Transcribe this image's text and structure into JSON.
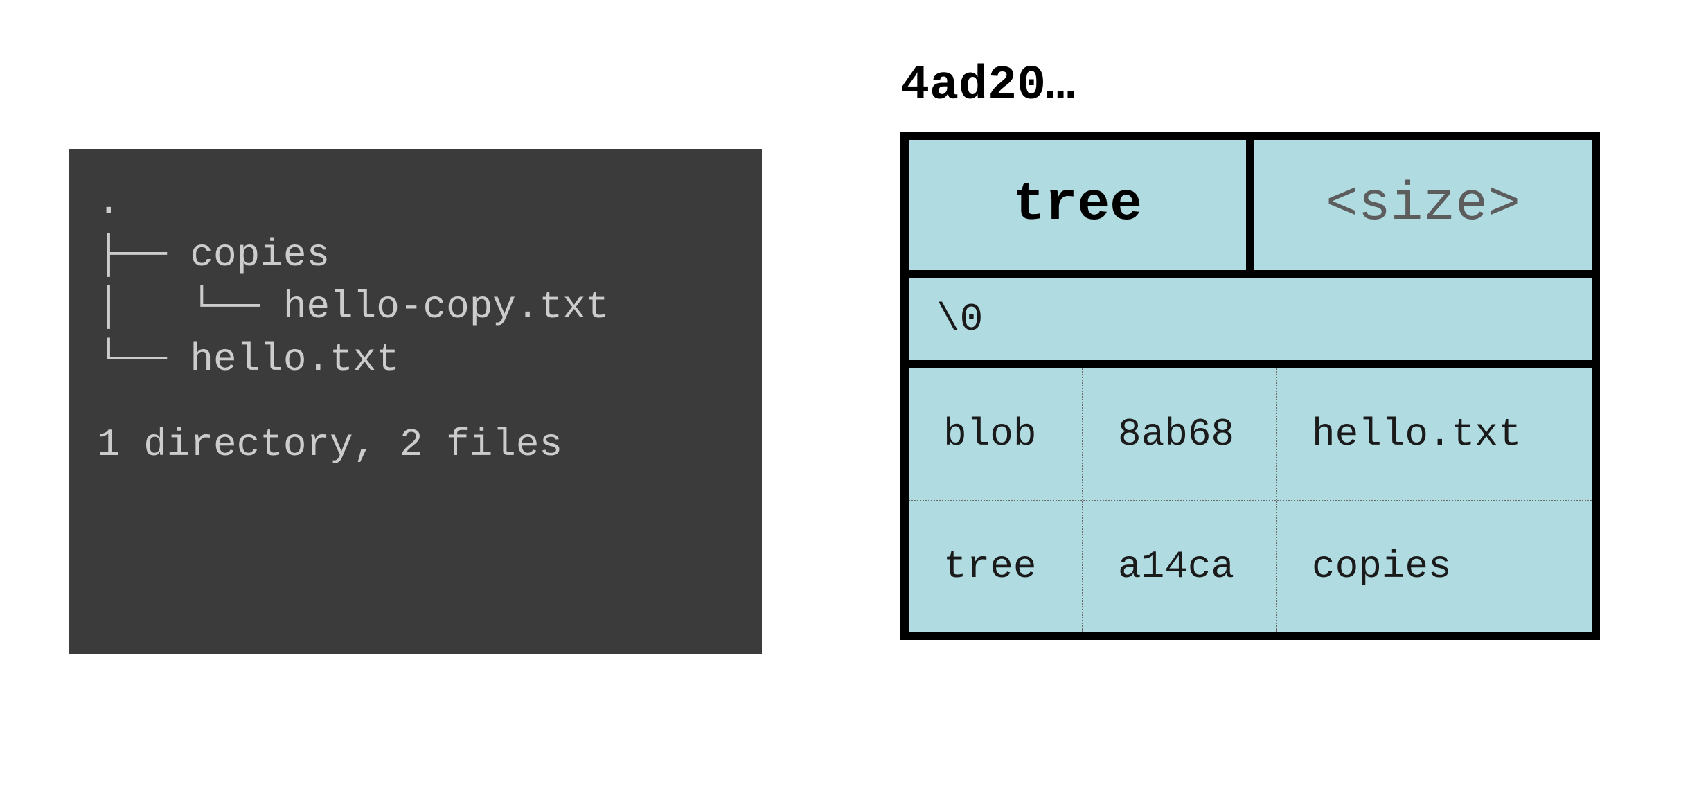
{
  "terminal": {
    "treeOutput": ".\n├── copies\n│   └── hello-copy.txt\n└── hello.txt",
    "summary": "1 directory, 2 files"
  },
  "treeObject": {
    "hashLabel": "4ad20…",
    "header": {
      "type": "tree",
      "size": "<size>"
    },
    "nullByte": "\\0",
    "entries": [
      {
        "mode": "blob",
        "hash": "8ab68",
        "name": "hello.txt"
      },
      {
        "mode": "tree",
        "hash": "a14ca",
        "name": "copies"
      }
    ]
  }
}
